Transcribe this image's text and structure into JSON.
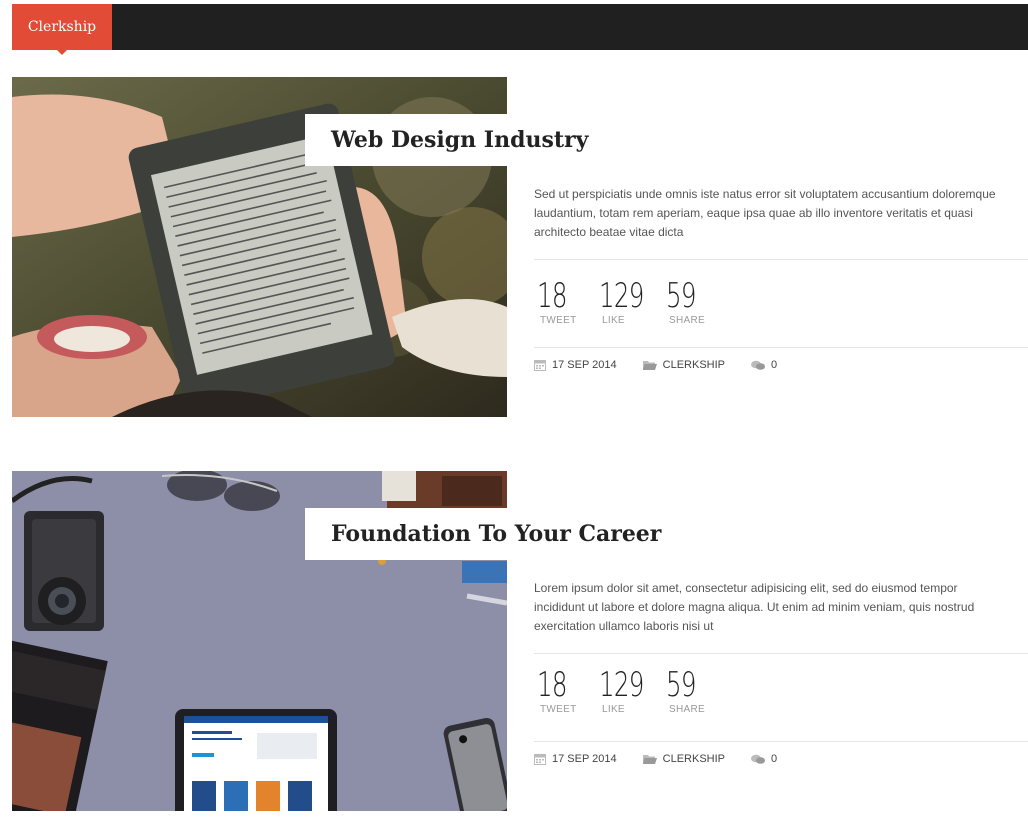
{
  "nav": {
    "tab_label": "Clerkship"
  },
  "posts": [
    {
      "title": "Web Design Industry",
      "excerpt": "Sed ut perspiciatis unde omnis iste natus error sit voluptatem accusantium doloremque laudantium, totam rem aperiam, eaque ipsa quae ab illo inventore veritatis et quasi architecto beatae vitae dicta",
      "stats": [
        {
          "value": "18",
          "label": "TWEET"
        },
        {
          "value": "129",
          "label": "LIKE"
        },
        {
          "value": "59",
          "label": "SHARE"
        }
      ],
      "date": "17 SEP 2014",
      "category": "CLERKSHIP",
      "comments": "0"
    },
    {
      "title": "Foundation To Your Career",
      "excerpt": "Lorem ipsum dolor sit amet, consectetur adipisicing elit, sed do eiusmod tempor incididunt ut labore et dolore magna aliqua. Ut enim ad minim veniam, quis nostrud exercitation ullamco laboris nisi ut",
      "stats": [
        {
          "value": "18",
          "label": "TWEET"
        },
        {
          "value": "129",
          "label": "LIKE"
        },
        {
          "value": "59",
          "label": "SHARE"
        }
      ],
      "date": "17 SEP 2014",
      "category": "CLERKSHIP",
      "comments": "0"
    }
  ],
  "colors": {
    "accent": "#e24b36",
    "topbar": "#202020"
  }
}
